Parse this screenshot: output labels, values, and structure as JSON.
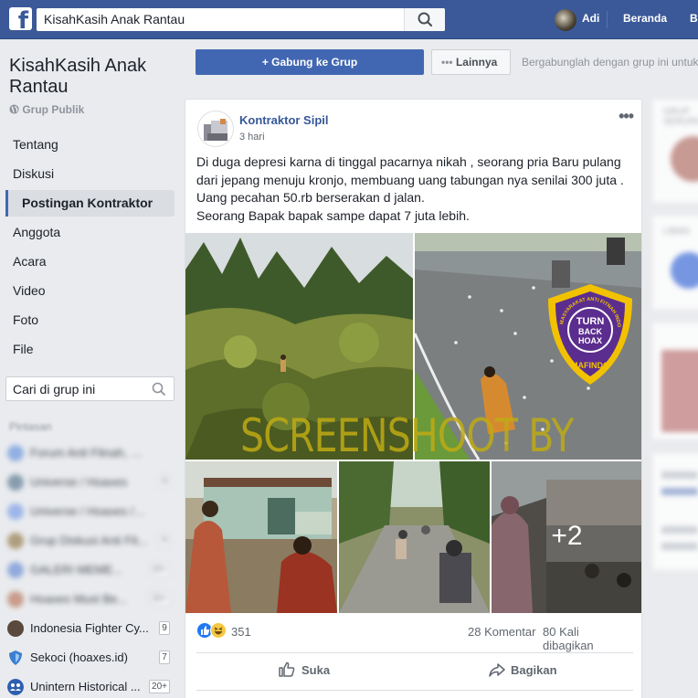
{
  "topbar": {
    "logo": "f",
    "search_value": "KisahKasih Anak Rantau",
    "user_name": "Adi",
    "home_label": "Beranda",
    "next_label": "B"
  },
  "group": {
    "title": "KisahKasih Anak Rantau",
    "type": "Grup Publik"
  },
  "nav": [
    {
      "label": "Tentang"
    },
    {
      "label": "Diskusi"
    },
    {
      "label": "Postingan Kontraktor",
      "active": true
    },
    {
      "label": "Anggota"
    },
    {
      "label": "Acara"
    },
    {
      "label": "Video"
    },
    {
      "label": "Foto"
    },
    {
      "label": "File"
    }
  ],
  "group_search": {
    "placeholder": "Cari di grup ini"
  },
  "shortcuts": {
    "heading": "Pintasan",
    "items": [
      {
        "label": "Forum Anti Fitnah, Has...",
        "count": "",
        "color": "#7aa0e0"
      },
      {
        "label": "Universe / Hoaxes",
        "count": "9",
        "color": "#6e8a9e"
      },
      {
        "label": "Universe / Hoaxes / Fo...",
        "count": "",
        "color": "#8aa8e8"
      },
      {
        "label": "Grup Diskusi Anti Fit...",
        "count": "9",
        "color": "#a08a60"
      },
      {
        "label": "GALERI MEME...",
        "count": "20+",
        "color": "#7a9ad8"
      },
      {
        "label": "Hoaxes Must Be...",
        "count": "20+",
        "color": "#c08870"
      },
      {
        "label": "Indonesia Fighter Cy...",
        "count": "9",
        "color": "#5a4a3e"
      },
      {
        "label": "Sekoci (hoaxes.id)",
        "count": "7",
        "color": "#3b7fd0"
      },
      {
        "label": "Unintern Historical ...",
        "count": "20+",
        "color": "#2d5fb0"
      }
    ]
  },
  "actions": {
    "join_label": "+ Gabung ke Grup",
    "more_label": "Lainnya",
    "invite_text": "Bergabunglah dengan grup ini untuk"
  },
  "post": {
    "author": "Kontraktor Sipil",
    "time": "3 hari",
    "text_lines": [
      "Di duga depresi karna di tinggal pacarnya nikah , seorang pria Baru pulang",
      "dari jepang menuju kronjo, membuang uang tabungan nya senilai 300 juta .",
      "Uang pecahan 50.rb berserakan d jalan.",
      "Seorang Bapak bapak sampe dapat 7 juta lebih."
    ],
    "more_photos": "+2",
    "watermark": "SCREENSHOOT BY",
    "badge": {
      "arc_text": "MASYARAKAT ANTI FITNAH INDONESIA",
      "line1": "TURN",
      "line2": "BACK",
      "line3": "HOAX",
      "bottom": "MAFINDO"
    },
    "reactions_count": "351",
    "comments": "28 Komentar",
    "shares": "80 Kali dibagikan",
    "like_label": "Suka",
    "share_label": "Bagikan"
  },
  "right_column": {
    "label1": "GRUP SERUPA",
    "label2": "LIBAN"
  },
  "colors": {
    "brand": "#3b5998",
    "link": "#365899",
    "button": "#4267b2",
    "watermark": "#bea914",
    "badge_purple": "#5b2d8e",
    "badge_gold": "#f2c200"
  }
}
